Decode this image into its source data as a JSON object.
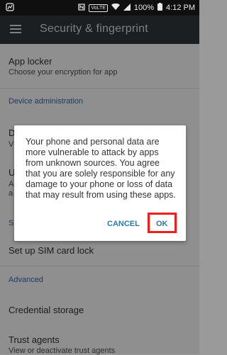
{
  "status_bar": {
    "network_badge": "VoLTE",
    "battery": "100%",
    "time": "4:12 PM"
  },
  "toolbar": {
    "title": "Security & fingerprint",
    "menu_icon": "hamburger-menu-icon"
  },
  "settings": {
    "app_locker": {
      "title": "App locker",
      "subtitle": "Choose your encryption for app"
    },
    "category_device_admin": "Device administration",
    "partial_items": [
      "D",
      "V",
      "U",
      "A",
      "a",
      "S"
    ],
    "sim_lock": {
      "title": "Set up SIM card lock"
    },
    "category_advanced": "Advanced",
    "credential_storage": {
      "title": "Credential storage"
    },
    "trust_agents": {
      "title": "Trust agents",
      "subtitle": "View or deactivate trust agents"
    }
  },
  "dialog": {
    "message": "Your phone and personal data are more vulnerable to attack by apps from unknown sources. You agree that you are solely responsible for any damage to your phone or loss of data that may result from using these apps.",
    "cancel_label": "CANCEL",
    "ok_label": "OK"
  }
}
